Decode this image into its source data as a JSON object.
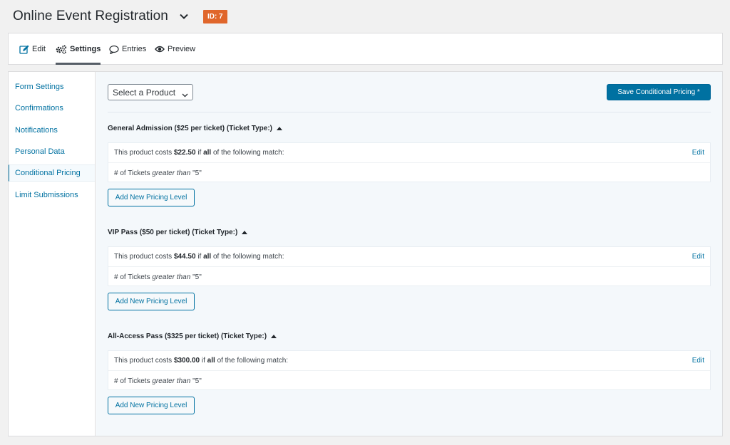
{
  "header": {
    "title": "Online Event Registration",
    "id_badge": "ID: 7"
  },
  "tabs": [
    {
      "label": "Edit",
      "icon": "edit-icon"
    },
    {
      "label": "Settings",
      "icon": "gears-icon",
      "active": true
    },
    {
      "label": "Entries",
      "icon": "comment-icon"
    },
    {
      "label": "Preview",
      "icon": "eye-icon"
    }
  ],
  "sidebar": {
    "items": [
      {
        "label": "Form Settings"
      },
      {
        "label": "Confirmations"
      },
      {
        "label": "Notifications"
      },
      {
        "label": "Personal Data"
      },
      {
        "label": "Conditional Pricing",
        "active": true
      },
      {
        "label": "Limit Submissions"
      }
    ]
  },
  "toolbar": {
    "select_label": "Select a Product",
    "save_label": "Save Conditional Pricing *"
  },
  "products": [
    {
      "title": "General Admission ($25 per ticket) (Ticket Type:)",
      "prefix": "This product costs",
      "price": "$22.50",
      "mid": "if",
      "qualifier": "all",
      "suffix": "of the following match:",
      "edit": "Edit",
      "cond_field": "# of Tickets",
      "cond_op": "greater than",
      "cond_value": "\"5\"",
      "add_label": "Add New Pricing Level"
    },
    {
      "title": "VIP Pass ($50 per ticket) (Ticket Type:)",
      "prefix": "This product costs",
      "price": "$44.50",
      "mid": "if",
      "qualifier": "all",
      "suffix": "of the following match:",
      "edit": "Edit",
      "cond_field": "# of Tickets",
      "cond_op": "greater than",
      "cond_value": "\"5\"",
      "add_label": "Add New Pricing Level"
    },
    {
      "title": "All-Access Pass ($325 per ticket) (Ticket Type:)",
      "prefix": "This product costs",
      "price": "$300.00",
      "mid": "if",
      "qualifier": "all",
      "suffix": "of the following match:",
      "edit": "Edit",
      "cond_field": "# of Tickets",
      "cond_op": "greater than",
      "cond_value": "\"5\"",
      "add_label": "Add New Pricing Level"
    }
  ],
  "colors": {
    "accent": "#0071a1",
    "badge": "#e0662b"
  }
}
